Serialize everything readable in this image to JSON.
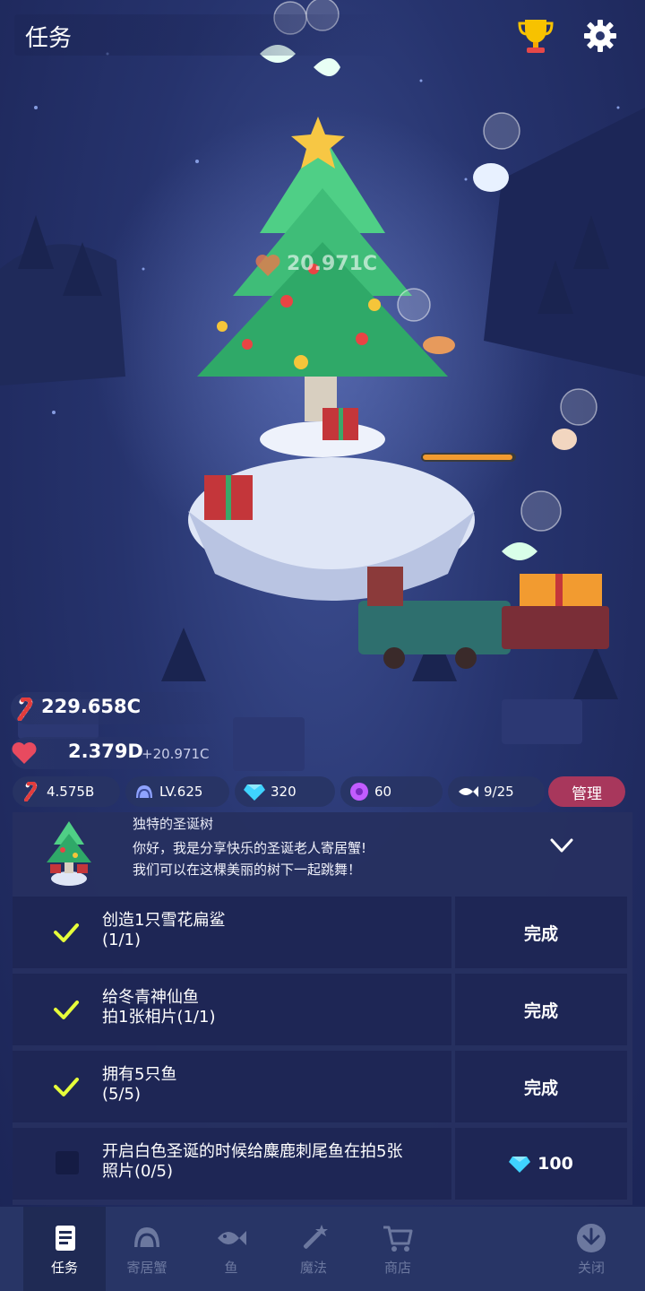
{
  "header": {
    "title": "任务"
  },
  "scene": {
    "heart_total": "20.971C"
  },
  "stats": {
    "candy": "229.658C",
    "love": "2.379D",
    "love_rate": "+20.971C",
    "pills": {
      "candy_rate": "4.575B",
      "level": "LV.625",
      "gems": "320",
      "pearls": "60",
      "fish": "9/25"
    },
    "manage_label": "管理"
  },
  "story": {
    "title": "独特的圣诞树",
    "line1": "你好，我是分享快乐的圣诞老人寄居蟹!",
    "line2": "我们可以在这棵美丽的树下一起跳舞！"
  },
  "tasks": [
    {
      "line1": "创造1只雪花扁鲨",
      "line2": "(1/1)",
      "done": true,
      "action": "完成"
    },
    {
      "line1": "给冬青神仙鱼",
      "line2": "拍1张相片(1/1)",
      "done": true,
      "action": "完成"
    },
    {
      "line1": "拥有5只鱼",
      "line2": "(5/5)",
      "done": true,
      "action": "完成"
    },
    {
      "line1": "开启白色圣诞的时候给麋鹿刺尾鱼在拍5张",
      "line2": "照片(0/5)",
      "done": false,
      "action": "100"
    }
  ],
  "nav": [
    {
      "label": "任务",
      "icon": "scroll-icon",
      "active": true
    },
    {
      "label": "寄居蟹",
      "icon": "hermit-crab-icon",
      "active": false
    },
    {
      "label": "鱼",
      "icon": "fish-icon",
      "active": false
    },
    {
      "label": "魔法",
      "icon": "magic-wand-icon",
      "active": false
    },
    {
      "label": "商店",
      "icon": "cart-icon",
      "active": false
    },
    {
      "label": "关闭",
      "icon": "close-arrow-icon",
      "active": false
    }
  ],
  "colors": {
    "manage": "#a8375c",
    "check": "#e6ff3a",
    "gem": "#3fd3ff",
    "pearl": "#c25cff"
  }
}
